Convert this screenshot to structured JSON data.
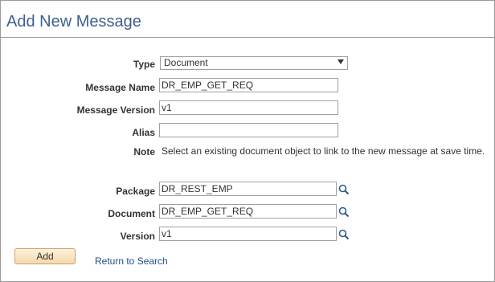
{
  "page": {
    "title": "Add New Message"
  },
  "form": {
    "type": {
      "label": "Type",
      "value": "Document"
    },
    "message_name": {
      "label": "Message Name",
      "value": "DR_EMP_GET_REQ"
    },
    "message_version": {
      "label": "Message Version",
      "value": "v1"
    },
    "alias": {
      "label": "Alias",
      "value": ""
    },
    "note": {
      "label": "Note",
      "text": "Select an existing document object to link to the new message at save time."
    },
    "package": {
      "label": "Package",
      "value": "DR_REST_EMP"
    },
    "document": {
      "label": "Document",
      "value": "DR_EMP_GET_REQ"
    },
    "version": {
      "label": "Version",
      "value": "v1"
    }
  },
  "actions": {
    "add_label": "Add",
    "return_label": "Return to Search"
  },
  "colors": {
    "title": "#3f5f8f",
    "link": "#1f4e85",
    "button_bg": "#f5d9ac"
  },
  "icons": {
    "lookup": "magnifier-icon",
    "dropdown": "chevron-down-icon"
  }
}
